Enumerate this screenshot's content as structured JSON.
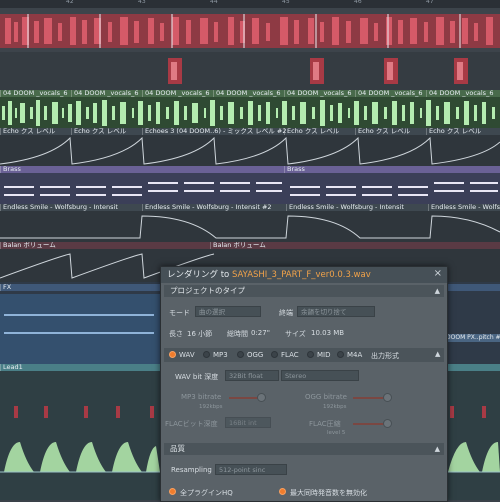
{
  "ruler": {
    "bars": [
      "42",
      "43",
      "44",
      "45",
      "46",
      "47"
    ]
  },
  "clips": {
    "doom_label": "04 DOOM _vocals_6",
    "echo_label": "Echo クス レベル",
    "echoes3_label": "Echoes 3 (04 DOOM..6) - ミックス レベル #2",
    "brass_label": "Brass",
    "endless_label": "Endless Smile - Wolfsburg - Intensit",
    "endless2_label": "Endless Smile - Wolfsburg - Intensit #2",
    "balan_label": "Balan ボリューム",
    "fx_label": "FX",
    "fx_right_label": "DOOM PX..pitch #2",
    "lead_label": "Lead1"
  },
  "dialog": {
    "title_prefix": "レンダリング to ",
    "filename": "SAYASHI_3_PART_F_ver0.0.3.wav",
    "close": "×",
    "project": {
      "header": "プロジェクトのタイプ",
      "mode_label": "モード",
      "mode_value": "曲の選択",
      "tail_label": "終端",
      "tail_value": "余韻を切り捨て",
      "length_label": "長さ",
      "length_value": "16 小節",
      "total_label": "総時間",
      "total_value": "0:27\"",
      "size_label": "サイズ",
      "size_value": "10.03 MB"
    },
    "format": {
      "options": [
        "WAV",
        "MP3",
        "OGG",
        "FLAC",
        "MID",
        "M4A"
      ],
      "selected": "WAV",
      "header": "出力形式",
      "wav_bit_label": "WAV bit 深度",
      "wav_bit_value": "32Bit float",
      "stereo_value": "Stereo",
      "mp3_label": "MP3 bitrate",
      "mp3_value": "192kbps",
      "ogg_label": "OGG bitrate",
      "ogg_value": "192kbps",
      "flac_label": "FLACビット深度",
      "flac_value": "16Bit int",
      "flac_comp_label": "FLAC圧縮",
      "flac_comp_value": "level 5"
    },
    "quality": {
      "header": "品質",
      "resampling_label": "Resampling",
      "resampling_value": "512-point sinc",
      "all_plugins_hq": "全プラグインHQ",
      "max_polyphony": "最大同時発音数を無効化"
    }
  },
  "colors": {
    "accent": "#f07c2c",
    "brass_lane": "#6a6196",
    "lead_lane": "#4a7f87",
    "vocal_wave": "#b4ecb0",
    "red_clip": "#a83a45"
  }
}
